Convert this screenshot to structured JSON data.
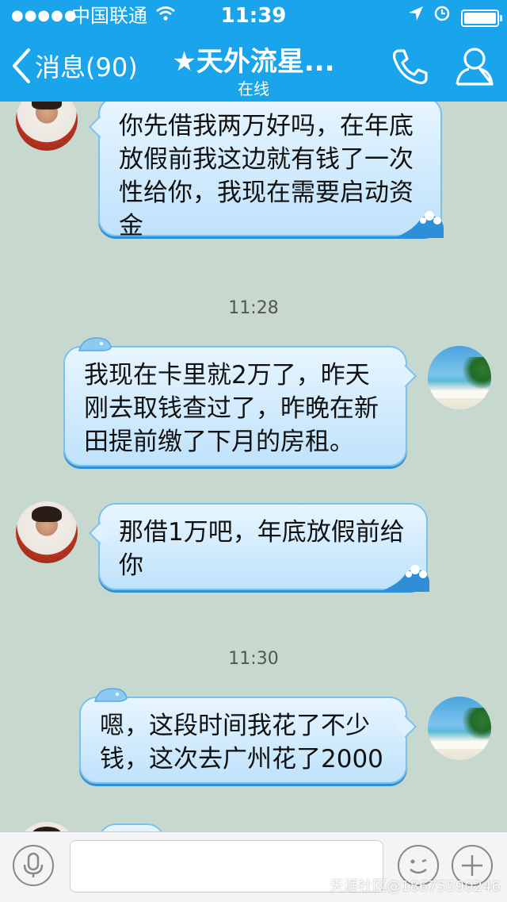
{
  "status_bar": {
    "signal": "●●●●●",
    "carrier": "中国联通",
    "time": "11:39"
  },
  "header": {
    "back_label": "消息(90)",
    "title": "★天外流星...",
    "subtitle": "在线"
  },
  "messages": [
    {
      "side": "left",
      "text": "你先借我两万好吗，在年底放假前我这边就有钱了一次性给你，我现在需要启动资金"
    },
    {
      "time": "11:28"
    },
    {
      "side": "right",
      "text": "我现在卡里就2万了，昨天刚去取钱查过了，昨晚在新田提前缴了下月的房租。"
    },
    {
      "side": "left",
      "text": "那借1万吧，年底放假前给你"
    },
    {
      "time": "11:30"
    },
    {
      "side": "right",
      "text": "嗯，这段时间我花了不少钱，这次去广州花了2000"
    }
  ],
  "input": {
    "placeholder": ""
  },
  "watermark": "天涯社区@18675590246",
  "colors": {
    "header": "#1aa4ec",
    "background": "#c7d9cf",
    "bubble_border": "#7cc0ec"
  }
}
